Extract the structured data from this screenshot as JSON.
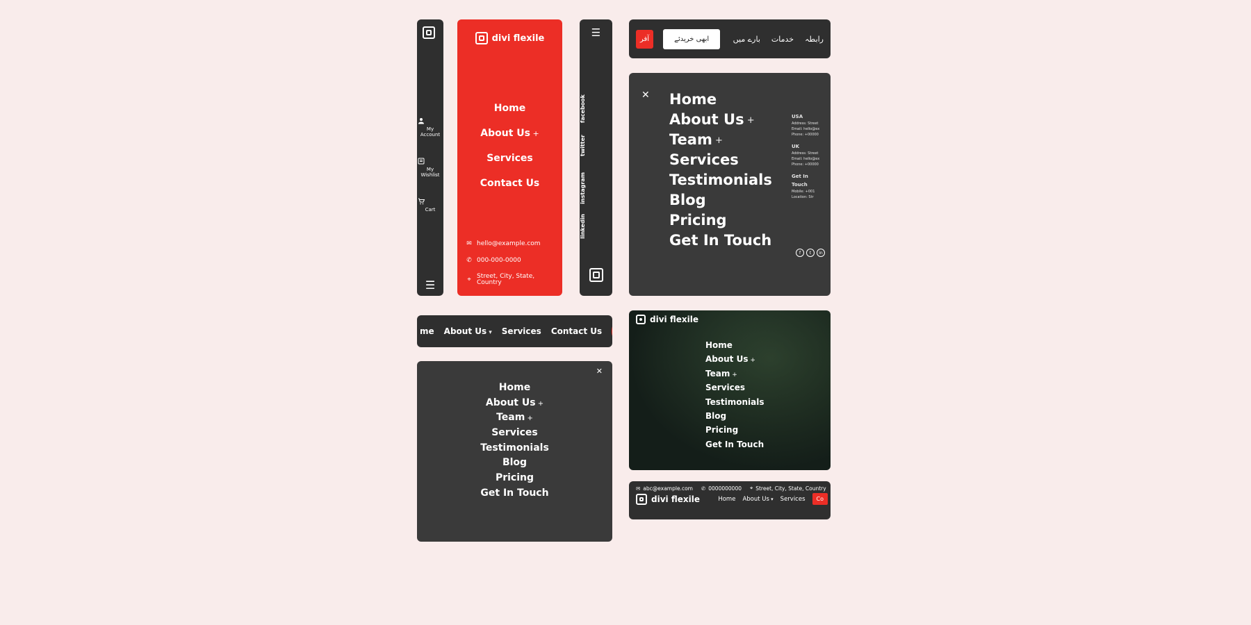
{
  "brand": {
    "name": "divi flexile"
  },
  "panelA": {
    "items": [
      {
        "label": "My Account"
      },
      {
        "label": "My Wishlist"
      },
      {
        "label": "Cart"
      }
    ]
  },
  "panelB": {
    "nav": [
      "Home",
      "About Us",
      "Services",
      "Contact Us"
    ],
    "expand_index": 1,
    "email": "hello@example.com",
    "phone": "000-000-0000",
    "address": "Street, City, State, Country"
  },
  "panelC": {
    "social": [
      "facebook",
      "twitter",
      "instagram",
      "linkedin"
    ]
  },
  "panelD": {
    "tag": "آفر",
    "buy": "ابھی خریدئے",
    "links": [
      "رابطہ",
      "خدمات",
      "بارے میں"
    ]
  },
  "panelE": {
    "nav": [
      "Home",
      "About Us",
      "Team",
      "Services",
      "Testimonials",
      "Blog",
      "Pricing",
      "Get In Touch"
    ],
    "expand": [
      1,
      2
    ],
    "side": {
      "regions": [
        "USA",
        "UK"
      ],
      "region_lines": [
        "Address: Street",
        "Email: hello@ex",
        "Phone: +00000"
      ],
      "touch_head": "Get In Touch",
      "touch_lines": [
        "Mobile: +001",
        "Location: Str"
      ]
    }
  },
  "panelF": {
    "nav": [
      "me",
      "About Us",
      "Services",
      "Contact Us"
    ],
    "dd_index": 1
  },
  "panelG": {
    "nav": [
      "Home",
      "About Us",
      "Team",
      "Services",
      "Testimonials",
      "Blog",
      "Pricing",
      "Get In Touch"
    ],
    "expand": [
      1,
      2
    ]
  },
  "panelH": {
    "nav": [
      "Home",
      "About Us",
      "Team",
      "Services",
      "Testimonials",
      "Blog",
      "Pricing",
      "Get In Touch"
    ],
    "expand": [
      1,
      2
    ]
  },
  "panelI": {
    "email": "abc@example.com",
    "phone": "0000000000",
    "address": "Street, City, State, Country",
    "nav": [
      "Home",
      "About Us",
      "Services"
    ],
    "dd_index": 1,
    "cta": "Co"
  }
}
